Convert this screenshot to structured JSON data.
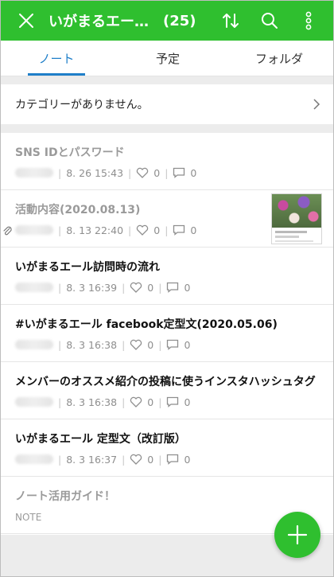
{
  "header": {
    "title": "いがまるエー…",
    "count": "(25)",
    "close_icon": "close-icon",
    "sort_icon": "sort-icon",
    "search_icon": "search-icon",
    "more_icon": "more-vertical-icon",
    "color": "#2fbf2f"
  },
  "tabs": [
    {
      "label": "ノート",
      "active": true
    },
    {
      "label": "予定",
      "active": false
    },
    {
      "label": "フォルダ",
      "active": false
    }
  ],
  "category": {
    "text": "カテゴリーがありません。"
  },
  "notes": [
    {
      "title": "SNS IDとパスワード",
      "date": "8. 26 15:43",
      "likes": "0",
      "comments": "0",
      "dim": true
    },
    {
      "title": "活動内容(2020.08.13)",
      "date": "8. 13 22:40",
      "likes": "0",
      "comments": "0",
      "dim": true,
      "attachment": true,
      "thumbnail": true
    },
    {
      "title": "いがまるエール訪問時の流れ",
      "date": "8. 3 16:39",
      "likes": "0",
      "comments": "0"
    },
    {
      "title": "#いがまるエール facebook定型文(2020.05.06)",
      "date": "8. 3 16:38",
      "likes": "0",
      "comments": "0"
    },
    {
      "title": "メンバーのオススメ紹介の投稿に使うインスタハッシュタグ",
      "date": "8. 3 16:38",
      "likes": "0",
      "comments": "0"
    },
    {
      "title": "いがまるエール 定型文（改訂版）",
      "date": "8. 3 16:37",
      "likes": "0",
      "comments": "0"
    },
    {
      "title": "ノート活用ガイド！",
      "note_label": "NOTE"
    }
  ],
  "fab": {
    "icon": "plus-icon",
    "color": "#2fbf2f"
  }
}
